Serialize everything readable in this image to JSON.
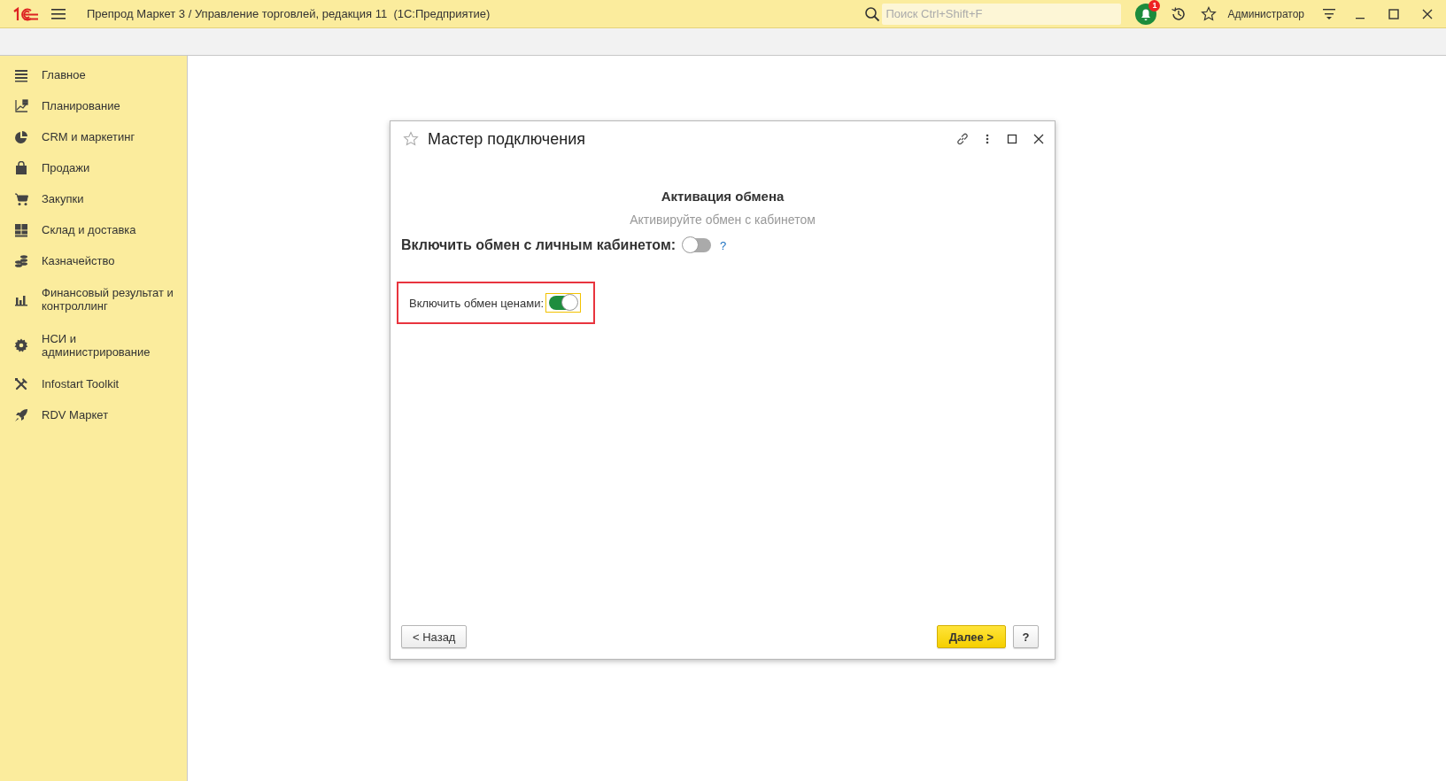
{
  "app_bar": {
    "title": "Препрод Маркет 3 / Управление торговлей, редакция 11  (1С:Предприятие)",
    "search": {
      "placeholder": "Поиск Ctrl+Shift+F"
    },
    "notification_count": "1",
    "user": "Администратор"
  },
  "sidebar": {
    "items": [
      {
        "label": "Главное"
      },
      {
        "label": "Планирование"
      },
      {
        "label": "CRM и маркетинг"
      },
      {
        "label": "Продажи"
      },
      {
        "label": "Закупки"
      },
      {
        "label": "Склад и доставка"
      },
      {
        "label": "Казначейство"
      },
      {
        "label": "Финансовый результат и контроллинг"
      },
      {
        "label": "НСИ и администрирование"
      },
      {
        "label": "Infostart Toolkit"
      },
      {
        "label": "RDV Маркет"
      }
    ]
  },
  "dialog": {
    "title": "Мастер подключения",
    "heading": "Активация обмена",
    "subheading": "Активируйте обмен с кабинетом",
    "switches": [
      {
        "kind": "main",
        "label": "Включить обмен с личным кабинетом:",
        "on": false,
        "focused": false,
        "highlighted": false,
        "help": "?"
      },
      {
        "kind": "plain",
        "label": "Включить обмен ценами:",
        "on": true,
        "focused": true,
        "highlighted": true
      }
    ],
    "buttons": [
      {
        "label": "< Назад",
        "kind": "normal"
      },
      {
        "label": "Далее >",
        "kind": "default"
      },
      {
        "label": "?",
        "kind": "normal"
      }
    ]
  }
}
